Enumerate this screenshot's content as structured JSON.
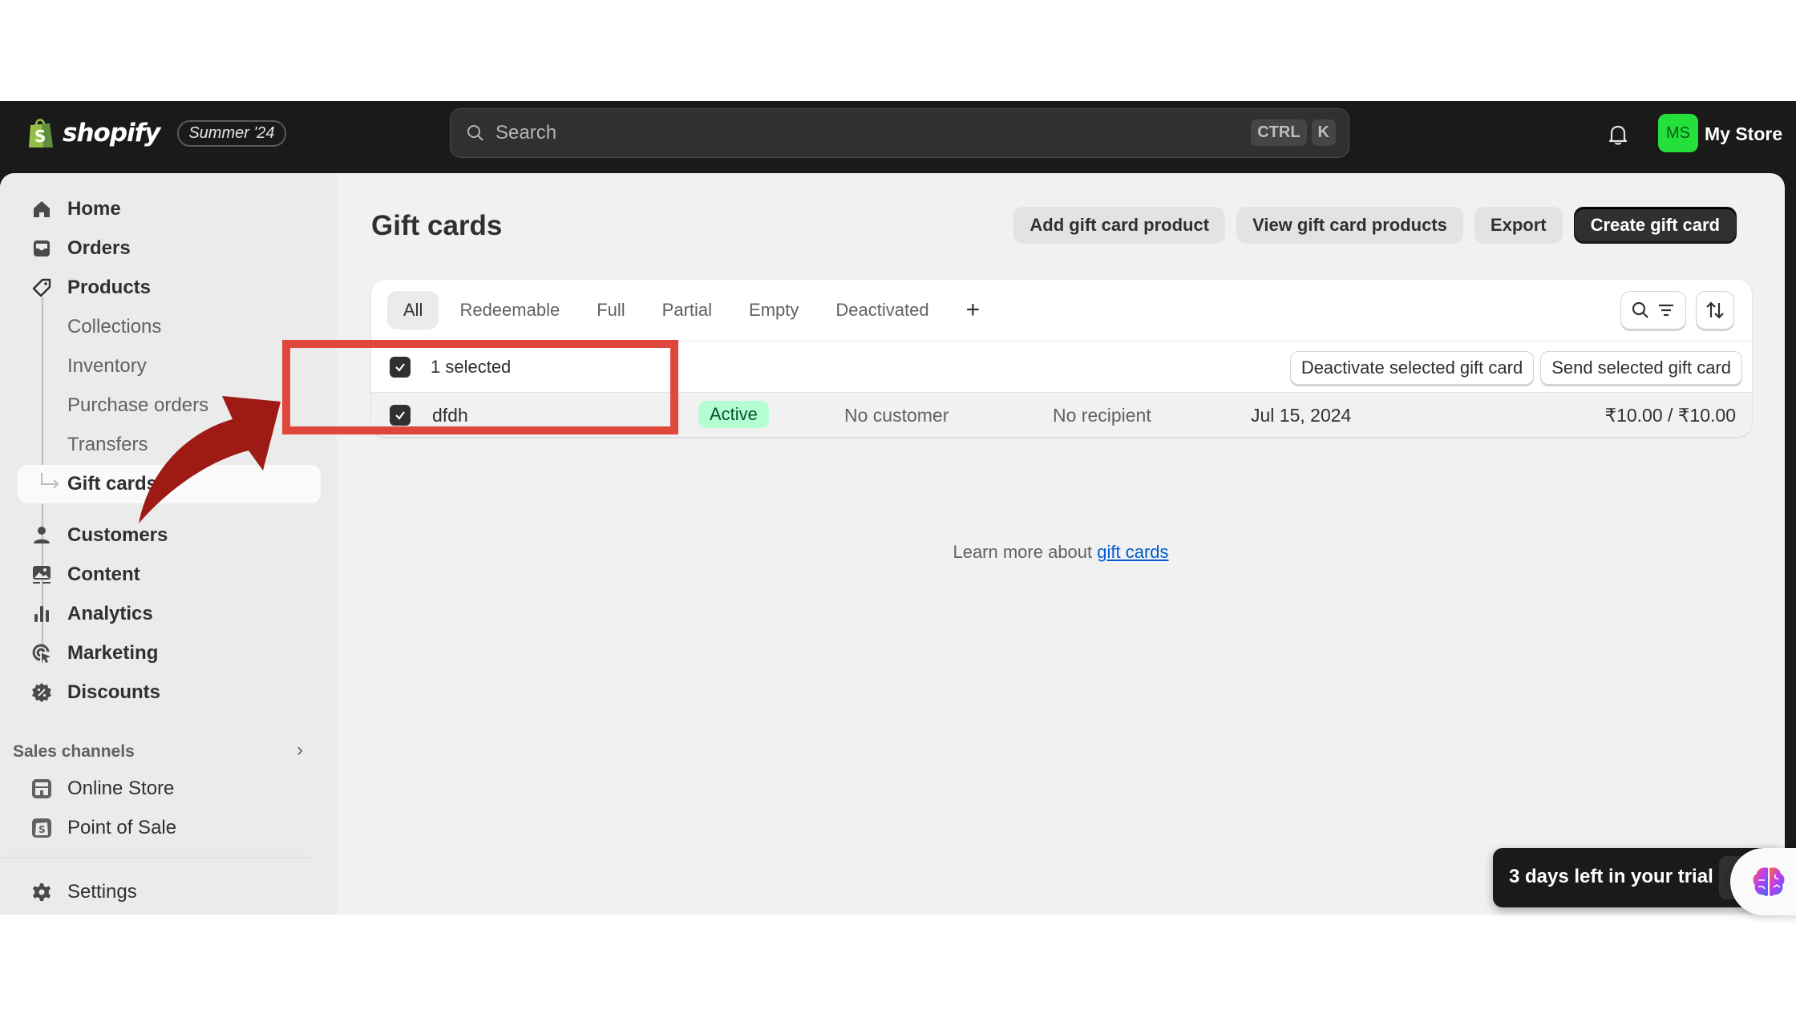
{
  "topbar": {
    "brand": "shopify",
    "edition_badge": "Summer '24",
    "search_placeholder": "Search",
    "shortcut_keys": [
      "CTRL",
      "K"
    ],
    "avatar_initials": "MS",
    "store_name": "My Store",
    "avatar_color": "#25e03b"
  },
  "sidebar": {
    "items": [
      {
        "label": "Home",
        "icon": "home-icon"
      },
      {
        "label": "Orders",
        "icon": "inbox-icon"
      },
      {
        "label": "Products",
        "icon": "tag-icon"
      },
      {
        "label": "Collections"
      },
      {
        "label": "Inventory"
      },
      {
        "label": "Purchase orders"
      },
      {
        "label": "Transfers"
      },
      {
        "label": "Gift cards",
        "active": true
      },
      {
        "label": "Customers",
        "icon": "person-icon"
      },
      {
        "label": "Content",
        "icon": "image-icon"
      },
      {
        "label": "Analytics",
        "icon": "bar-chart-icon"
      },
      {
        "label": "Marketing",
        "icon": "target-icon"
      },
      {
        "label": "Discounts",
        "icon": "discount-icon"
      }
    ],
    "sales_channels_label": "Sales channels",
    "channels": [
      {
        "label": "Online Store",
        "icon": "store-icon"
      },
      {
        "label": "Point of Sale",
        "icon": "pos-icon"
      }
    ],
    "settings_label": "Settings"
  },
  "page": {
    "title": "Gift cards",
    "actions": {
      "add_product": "Add gift card product",
      "view_products": "View gift card products",
      "export": "Export",
      "create": "Create gift card"
    },
    "tabs": [
      "All",
      "Redeemable",
      "Full",
      "Partial",
      "Empty",
      "Deactivated"
    ],
    "active_tab": "All",
    "bulk": {
      "selected_text": "1 selected",
      "deactivate": "Deactivate selected gift card",
      "send": "Send selected gift card"
    },
    "rows": [
      {
        "code": "dfdh",
        "status": "Active",
        "customer": "No customer",
        "recipient": "No recipient",
        "date": "Jul 15, 2024",
        "balance": "₹10.00 / ₹10.00",
        "selected": true
      }
    ],
    "learn_more_prefix": "Learn more about ",
    "learn_more_link": "gift cards"
  },
  "trial_banner": {
    "text": "3 days left in your trial"
  },
  "annotation": {
    "highlight_color": "#e0473c",
    "arrow_color": "#9e1a14"
  }
}
